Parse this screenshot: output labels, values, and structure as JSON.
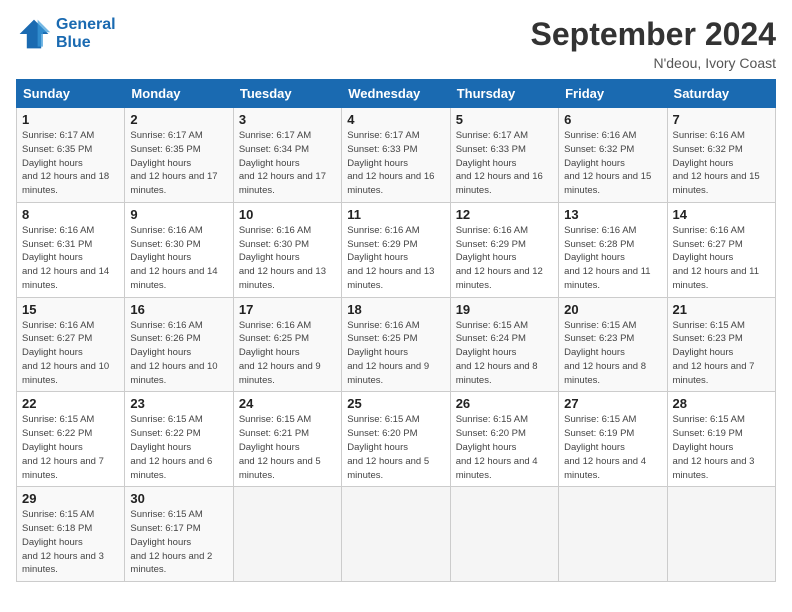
{
  "logo": {
    "line1": "General",
    "line2": "Blue"
  },
  "title": "September 2024",
  "subtitle": "N'deou, Ivory Coast",
  "days_of_week": [
    "Sunday",
    "Monday",
    "Tuesday",
    "Wednesday",
    "Thursday",
    "Friday",
    "Saturday"
  ],
  "weeks": [
    [
      {
        "day": "1",
        "sunrise": "6:17 AM",
        "sunset": "6:35 PM",
        "daylight": "12 hours and 18 minutes."
      },
      {
        "day": "2",
        "sunrise": "6:17 AM",
        "sunset": "6:35 PM",
        "daylight": "12 hours and 17 minutes."
      },
      {
        "day": "3",
        "sunrise": "6:17 AM",
        "sunset": "6:34 PM",
        "daylight": "12 hours and 17 minutes."
      },
      {
        "day": "4",
        "sunrise": "6:17 AM",
        "sunset": "6:33 PM",
        "daylight": "12 hours and 16 minutes."
      },
      {
        "day": "5",
        "sunrise": "6:17 AM",
        "sunset": "6:33 PM",
        "daylight": "12 hours and 16 minutes."
      },
      {
        "day": "6",
        "sunrise": "6:16 AM",
        "sunset": "6:32 PM",
        "daylight": "12 hours and 15 minutes."
      },
      {
        "day": "7",
        "sunrise": "6:16 AM",
        "sunset": "6:32 PM",
        "daylight": "12 hours and 15 minutes."
      }
    ],
    [
      {
        "day": "8",
        "sunrise": "6:16 AM",
        "sunset": "6:31 PM",
        "daylight": "12 hours and 14 minutes."
      },
      {
        "day": "9",
        "sunrise": "6:16 AM",
        "sunset": "6:30 PM",
        "daylight": "12 hours and 14 minutes."
      },
      {
        "day": "10",
        "sunrise": "6:16 AM",
        "sunset": "6:30 PM",
        "daylight": "12 hours and 13 minutes."
      },
      {
        "day": "11",
        "sunrise": "6:16 AM",
        "sunset": "6:29 PM",
        "daylight": "12 hours and 13 minutes."
      },
      {
        "day": "12",
        "sunrise": "6:16 AM",
        "sunset": "6:29 PM",
        "daylight": "12 hours and 12 minutes."
      },
      {
        "day": "13",
        "sunrise": "6:16 AM",
        "sunset": "6:28 PM",
        "daylight": "12 hours and 11 minutes."
      },
      {
        "day": "14",
        "sunrise": "6:16 AM",
        "sunset": "6:27 PM",
        "daylight": "12 hours and 11 minutes."
      }
    ],
    [
      {
        "day": "15",
        "sunrise": "6:16 AM",
        "sunset": "6:27 PM",
        "daylight": "12 hours and 10 minutes."
      },
      {
        "day": "16",
        "sunrise": "6:16 AM",
        "sunset": "6:26 PM",
        "daylight": "12 hours and 10 minutes."
      },
      {
        "day": "17",
        "sunrise": "6:16 AM",
        "sunset": "6:25 PM",
        "daylight": "12 hours and 9 minutes."
      },
      {
        "day": "18",
        "sunrise": "6:16 AM",
        "sunset": "6:25 PM",
        "daylight": "12 hours and 9 minutes."
      },
      {
        "day": "19",
        "sunrise": "6:15 AM",
        "sunset": "6:24 PM",
        "daylight": "12 hours and 8 minutes."
      },
      {
        "day": "20",
        "sunrise": "6:15 AM",
        "sunset": "6:23 PM",
        "daylight": "12 hours and 8 minutes."
      },
      {
        "day": "21",
        "sunrise": "6:15 AM",
        "sunset": "6:23 PM",
        "daylight": "12 hours and 7 minutes."
      }
    ],
    [
      {
        "day": "22",
        "sunrise": "6:15 AM",
        "sunset": "6:22 PM",
        "daylight": "12 hours and 7 minutes."
      },
      {
        "day": "23",
        "sunrise": "6:15 AM",
        "sunset": "6:22 PM",
        "daylight": "12 hours and 6 minutes."
      },
      {
        "day": "24",
        "sunrise": "6:15 AM",
        "sunset": "6:21 PM",
        "daylight": "12 hours and 5 minutes."
      },
      {
        "day": "25",
        "sunrise": "6:15 AM",
        "sunset": "6:20 PM",
        "daylight": "12 hours and 5 minutes."
      },
      {
        "day": "26",
        "sunrise": "6:15 AM",
        "sunset": "6:20 PM",
        "daylight": "12 hours and 4 minutes."
      },
      {
        "day": "27",
        "sunrise": "6:15 AM",
        "sunset": "6:19 PM",
        "daylight": "12 hours and 4 minutes."
      },
      {
        "day": "28",
        "sunrise": "6:15 AM",
        "sunset": "6:19 PM",
        "daylight": "12 hours and 3 minutes."
      }
    ],
    [
      {
        "day": "29",
        "sunrise": "6:15 AM",
        "sunset": "6:18 PM",
        "daylight": "12 hours and 3 minutes."
      },
      {
        "day": "30",
        "sunrise": "6:15 AM",
        "sunset": "6:17 PM",
        "daylight": "12 hours and 2 minutes."
      },
      null,
      null,
      null,
      null,
      null
    ]
  ]
}
